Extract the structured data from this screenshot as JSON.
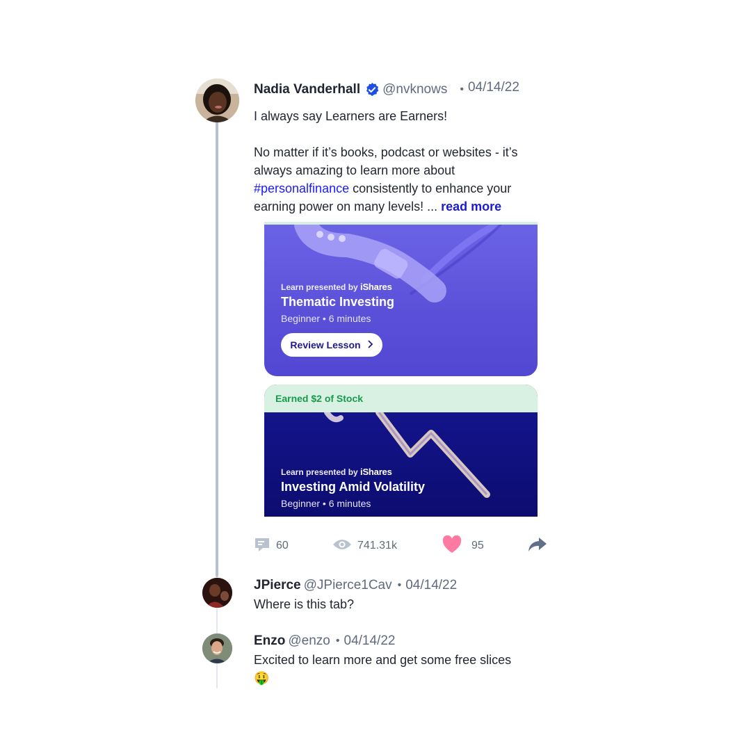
{
  "post": {
    "author_name": "Nadia Vanderhall",
    "handle": "@nvknows",
    "separator": "•",
    "date": "04/14/22",
    "line1": "I always say Learners are Earners!",
    "line2_prefix": "No matter if it’s books, podcast or websites - it’s always amazing to learn more about ",
    "hashtag": "#personalfinance",
    "line2_suffix": " consistently to enhance your earning power on many levels! ... ",
    "read_more": "read more"
  },
  "cards": [
    {
      "presented_label": "Learn presented by",
      "brand": "iShares",
      "title": "Thematic Investing",
      "meta": "Beginner • 6 minutes",
      "button_label": "Review Lesson",
      "button_icon": "chevron-right-icon"
    },
    {
      "banner": "Earned $2 of Stock",
      "presented_label": "Learn presented by",
      "brand": "iShares",
      "title": "Investing Amid Volatility",
      "meta": "Beginner • 6 minutes"
    }
  ],
  "actions": {
    "comments": "60",
    "views": "741.31k",
    "likes": "95",
    "icons": [
      "comment-icon",
      "eye-icon",
      "heart-icon",
      "share-icon"
    ]
  },
  "replies": [
    {
      "name": "JPierce",
      "handle": "@JPierce1Cav",
      "separator": "•",
      "date": "04/14/22",
      "text": "Where is this tab?"
    },
    {
      "name": "Enzo",
      "handle": "@enzo",
      "separator": "•",
      "date": "04/14/22",
      "text": "Excited to learn more and get some free slices",
      "emoji": "🤑"
    }
  ],
  "colors": {
    "link": "#1a1aff",
    "card1_bg": "#5a50d8",
    "card2_bg": "#0f0f7a",
    "earned_bg": "#d8f1e2",
    "earned_text": "#179a4c",
    "like": "#ff6f9a"
  }
}
